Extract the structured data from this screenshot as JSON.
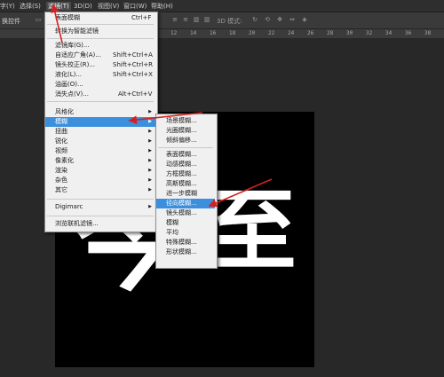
{
  "menubar": {
    "items": [
      {
        "label": "字(Y)"
      },
      {
        "label": "选择(S)"
      },
      {
        "label": "滤镜(T)"
      },
      {
        "label": "3D(D)"
      },
      {
        "label": "视图(V)"
      },
      {
        "label": "窗口(W)"
      },
      {
        "label": "帮助(H)"
      }
    ]
  },
  "options_bar": {
    "left_label": "换控件",
    "mode_label": "3D 模式:"
  },
  "ruler": {
    "ticks": [
      "12",
      "14",
      "16",
      "18",
      "20",
      "22",
      "24",
      "26",
      "28",
      "30",
      "32",
      "34",
      "36",
      "38"
    ]
  },
  "canvas_text": {
    "left": "今",
    "right": "至"
  },
  "filter_menu": {
    "items": [
      {
        "label": "表面模糊",
        "shortcut": "Ctrl+F"
      },
      {
        "label": "转换为智能滤镜"
      },
      {
        "label": "滤镜库(G)..."
      },
      {
        "label": "自适应广角(A)...",
        "shortcut": "Shift+Ctrl+A"
      },
      {
        "label": "镜头校正(R)...",
        "shortcut": "Shift+Ctrl+R"
      },
      {
        "label": "液化(L)...",
        "shortcut": "Shift+Ctrl+X"
      },
      {
        "label": "油画(O)..."
      },
      {
        "label": "消失点(V)...",
        "shortcut": "Alt+Ctrl+V"
      },
      {
        "label": "风格化"
      },
      {
        "label": "模糊"
      },
      {
        "label": "扭曲"
      },
      {
        "label": "锐化"
      },
      {
        "label": "视频"
      },
      {
        "label": "像素化"
      },
      {
        "label": "渲染"
      },
      {
        "label": "杂色"
      },
      {
        "label": "其它"
      },
      {
        "label": "Digimarc"
      },
      {
        "label": "浏览联机滤镜..."
      }
    ]
  },
  "blur_submenu": {
    "items": [
      {
        "label": "场景模糊..."
      },
      {
        "label": "光圈模糊..."
      },
      {
        "label": "倾斜偏移..."
      },
      {
        "label": "表面模糊..."
      },
      {
        "label": "动感模糊..."
      },
      {
        "label": "方框模糊..."
      },
      {
        "label": "高斯模糊..."
      },
      {
        "label": "进一步模糊"
      },
      {
        "label": "径向模糊..."
      },
      {
        "label": "镜头模糊..."
      },
      {
        "label": "模糊"
      },
      {
        "label": "平均"
      },
      {
        "label": "特殊模糊..."
      },
      {
        "label": "形状模糊..."
      }
    ]
  },
  "colors": {
    "highlight": "#3c8fdc",
    "annotation_arrow": "#d42020"
  }
}
